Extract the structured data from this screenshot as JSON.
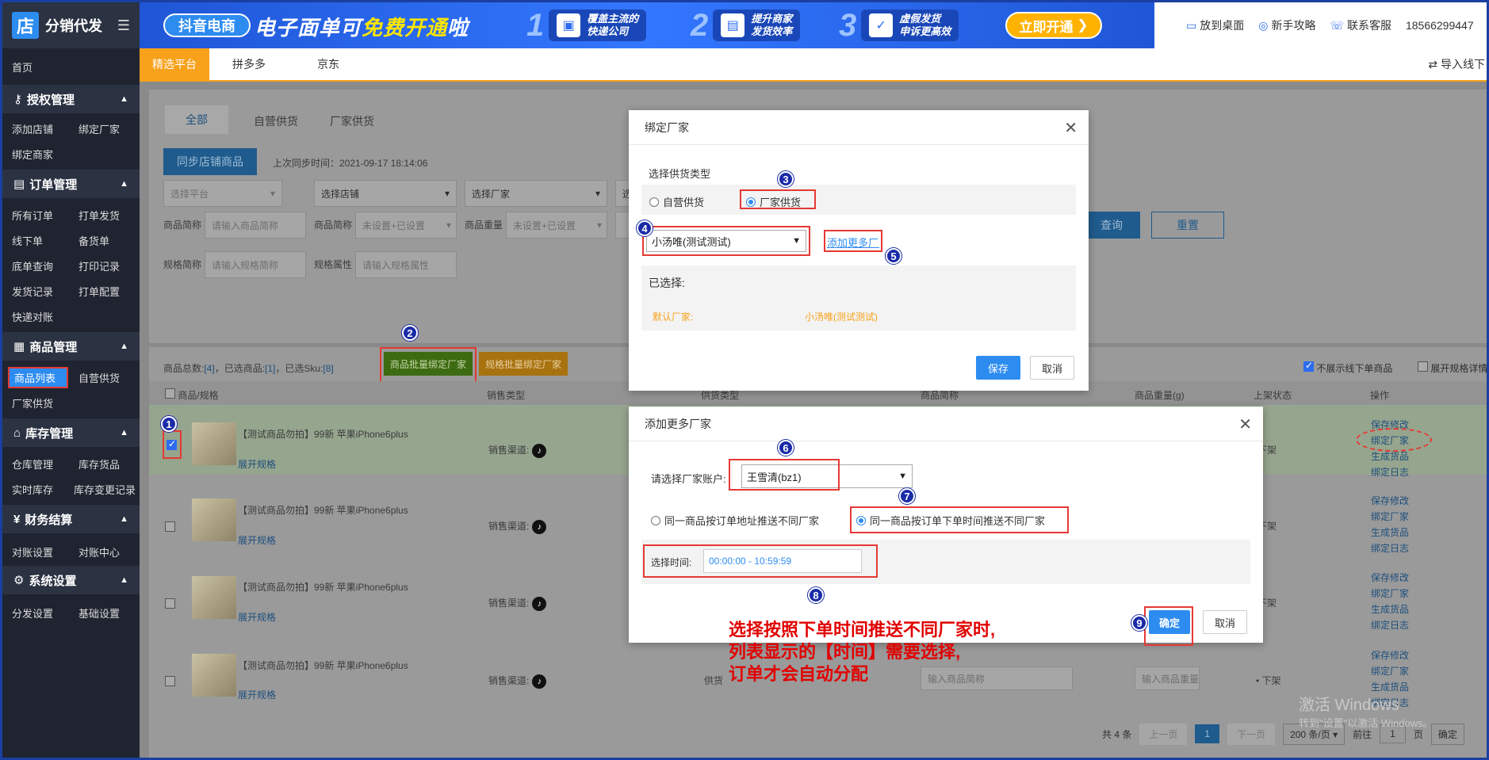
{
  "sidebar": {
    "logo_glyph": "店",
    "app_title": "分销代发",
    "menu_icon": "hamburger-icon",
    "home": "首页",
    "groups": [
      {
        "title": "授权管理",
        "icon": "user-key-icon",
        "items": [
          "添加店铺",
          "绑定厂家",
          "绑定商家"
        ]
      },
      {
        "title": "订单管理",
        "icon": "order-icon",
        "items": [
          "所有订单",
          "打单发货",
          "线下单",
          "备货单",
          "底单查询",
          "打印记录",
          "发货记录",
          "打单配置",
          "快递对账"
        ]
      },
      {
        "title": "商品管理",
        "icon": "goods-icon",
        "items": [
          "商品列表",
          "自营供货",
          "厂家供货"
        ]
      },
      {
        "title": "库存管理",
        "icon": "warehouse-icon",
        "items": [
          "仓库管理",
          "库存货品",
          "实时库存",
          "库存变更记录"
        ]
      },
      {
        "title": "财务结算",
        "icon": "yen-icon",
        "items": [
          "对账设置",
          "对账中心"
        ]
      },
      {
        "title": "系统设置",
        "icon": "settings-icon",
        "items": [
          "分发设置",
          "基础设置"
        ]
      }
    ]
  },
  "banner": {
    "pill": "抖音电商",
    "headline_a": "电子面单可",
    "headline_b": "免费开通",
    "headline_c": "啦",
    "steps": [
      {
        "num": "1",
        "text": "覆盖主流的\n快递公司"
      },
      {
        "num": "2",
        "text": "提升商家\n发货效率"
      },
      {
        "num": "3",
        "text": "虚假发货\n申诉更高效"
      }
    ],
    "cta": "立即开通"
  },
  "topbar": {
    "desktop": "放到桌面",
    "guide": "新手攻略",
    "support": "联系客服",
    "phone": "18566299447"
  },
  "platform_tabs": [
    "精选平台",
    "拼多多",
    "京东"
  ],
  "import_link": "导入线下",
  "supply_tabs": [
    "全部",
    "自营供货",
    "厂家供货"
  ],
  "sync": {
    "button": "同步店铺商品",
    "last_sync": "上次同步时间：2021-09-17 18:14:06"
  },
  "filters": {
    "row1": [
      "选择平台",
      "选择店铺",
      "选择厂家",
      "选择"
    ],
    "labels": [
      "商品简称",
      "商品简称",
      "商品重量",
      "规格简称",
      "规格属性"
    ],
    "placeholders": [
      "请输入商品简称",
      "未设置+已设置",
      "未设置+已设置",
      "请输入规格简称",
      "请输入规格属性"
    ],
    "query": "查询",
    "reset": "重置"
  },
  "summary": {
    "total_label": "商品总数:",
    "total": "[4]",
    "selected_label": "，已选商品:",
    "selected": "[1]",
    "sku_label": "，已选Sku:",
    "sku": "[8]",
    "bulk_bind": "商品批量绑定厂家",
    "spec_bind": "规格批量绑定厂家",
    "hide_offline": "不展示线下单商品",
    "expand_spec": "展开规格详情"
  },
  "table": {
    "headers": [
      "商品/规格",
      "销售类型",
      "供货类型",
      "商品简称",
      "商品重量(g)",
      "上架状态",
      "操作"
    ],
    "rows": [
      {
        "title": "【测试商品勿拍】99新 苹果iPhone6plus",
        "expand": "展开规格",
        "channel": "销售渠道:",
        "status": "下架",
        "ops": [
          "保存修改",
          "绑定厂家",
          "生成货品",
          "绑定日志"
        ]
      },
      {
        "title": "【测试商品勿拍】99新 苹果iPhone6plus",
        "expand": "展开规格",
        "channel": "销售渠道:",
        "status": "下架",
        "ops": [
          "保存修改",
          "绑定厂家",
          "生成货品",
          "绑定日志"
        ]
      },
      {
        "title": "【测试商品勿拍】99新 苹果iPhone6plus",
        "expand": "展开规格",
        "channel": "销售渠道:",
        "status": "下架",
        "ops": [
          "保存修改",
          "绑定厂家",
          "生成货品",
          "绑定日志"
        ]
      },
      {
        "title": "【测试商品勿拍】99新 苹果iPhone6plus",
        "expand": "展开规格",
        "channel": "销售渠道:",
        "supply": "供货",
        "name_ph": "输入商品简称",
        "weight_ph": "输入商品重量",
        "status": "下架",
        "ops": [
          "保存修改",
          "绑定厂家",
          "生成货品",
          "绑定日志"
        ]
      }
    ]
  },
  "pagination": {
    "total": "共 4 条",
    "prev": "上一页",
    "page": "1",
    "next": "下一页",
    "size": "200 条/页",
    "goto": "前往",
    "goto_page": "1",
    "unit": "页",
    "confirm": "确定"
  },
  "modal_bind": {
    "title": "绑定厂家",
    "type_label": "选择供货类型",
    "opt_self": "自营供货",
    "opt_factory": "厂家供货",
    "factory_selected": "小汤唯(测试测试)",
    "add_more": "添加更多厂家",
    "selected_label": "已选择:",
    "default_label": "默认厂家:",
    "default_value": "小汤唯(测试测试)",
    "save": "保存",
    "cancel": "取消"
  },
  "modal_add": {
    "title": "添加更多厂家",
    "account_label": "请选择厂家账户:",
    "account_value": "王雪清(bz1)",
    "opt_address": "同一商品按订单地址推送不同厂家",
    "opt_time": "同一商品按订单下单时间推送不同厂家",
    "time_label": "选择时间:",
    "time_value": "00:00:00 - 10:59:59",
    "ok": "确定",
    "cancel": "取消"
  },
  "annotations": [
    "1",
    "2",
    "3",
    "4",
    "5",
    "6",
    "7",
    "8",
    "9"
  ],
  "note": "选择按照下单时间推送不同厂家时,\n列表显示的【时间】需要选择,\n订单才会自动分配",
  "watermark": {
    "line1": "激活 Windows",
    "line2": "转到\"设置\"以激活 Windows。"
  },
  "colors": {
    "accent": "#2d8cf0",
    "orange": "#f7a21a",
    "annotation_red": "#e53935",
    "annotation_blue": "#1a2ba8"
  }
}
